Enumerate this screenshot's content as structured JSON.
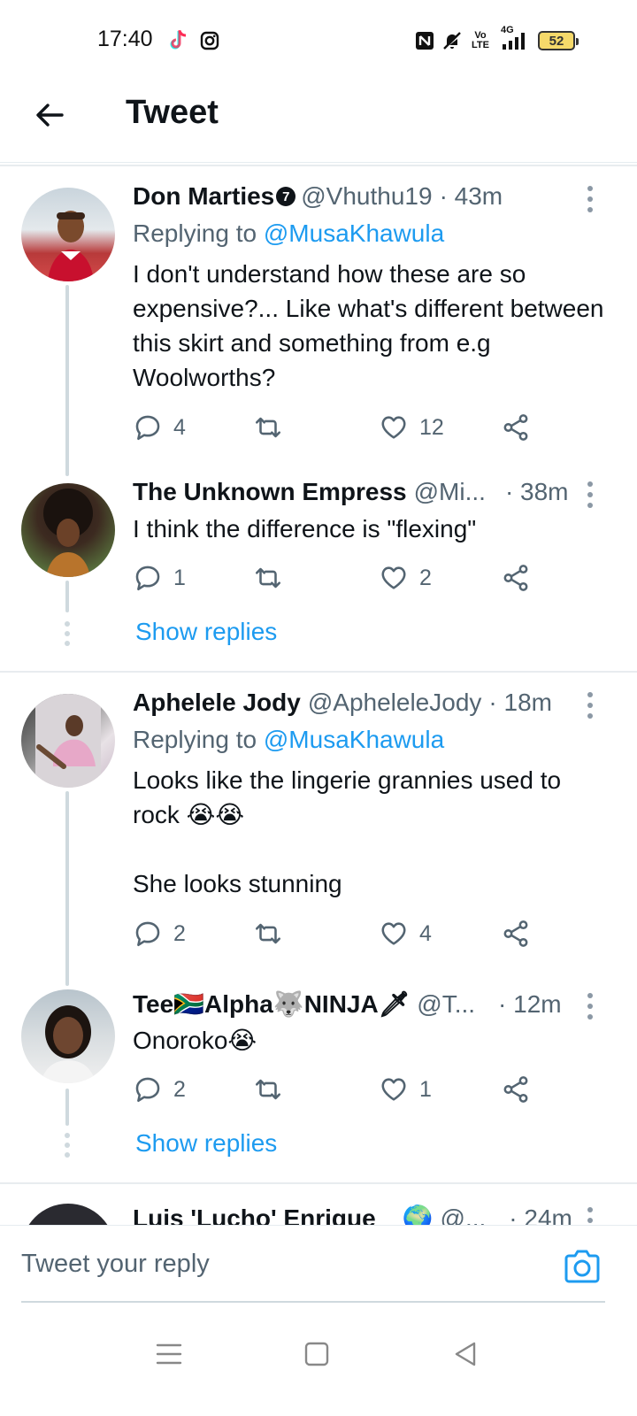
{
  "status_bar": {
    "time": "17:40",
    "battery": "52",
    "icons": [
      "tiktok-icon",
      "instagram-icon",
      "nfc-icon",
      "mute-icon",
      "volte-icon",
      "signal-4g-icon",
      "battery-icon"
    ],
    "volte_label": "Vo\nLTE",
    "network_label": "4G"
  },
  "header": {
    "title": "Tweet",
    "back_icon": "back-arrow-icon"
  },
  "tweets": [
    {
      "name": "Don Marties",
      "verified_badge": "7",
      "handle": "@Vhuthu19",
      "time": "· 43m",
      "reply_label": "Replying to ",
      "reply_mention": "@MusaKhawula",
      "text": "I don't understand how these are so expensive?... Like what's different between this skirt and something from e.g Woolworths?",
      "replies": "4",
      "retweets": "",
      "likes": "12"
    },
    {
      "name": "The Unknown Empress",
      "handle": "@Mi...",
      "time": "· 38m",
      "text": "I think the difference is \"flexing\"",
      "replies": "1",
      "retweets": "",
      "likes": "2",
      "show_replies": "Show replies"
    },
    {
      "name": "Aphelele Jody",
      "handle": "@ApheleleJody",
      "time": "· 18m",
      "reply_label": "Replying to ",
      "reply_mention": "@MusaKhawula",
      "text": "Looks like the lingerie grannies used to rock 😭😭\n\nShe looks stunning",
      "replies": "2",
      "retweets": "",
      "likes": "4"
    },
    {
      "name_parts": [
        "Tee",
        "🇿🇦",
        "Alpha",
        "🐺",
        " NINJA",
        "🗡"
      ],
      "handle": "@T...",
      "time": "· 12m",
      "text": "Onoroko😭",
      "replies": "2",
      "retweets": "",
      "likes": "1",
      "show_replies": "Show replies"
    },
    {
      "name": "Luis 'Lucho' Enrique",
      "name_emoji": "🌍",
      "handle": "@...",
      "time": "· 24m"
    }
  ],
  "reply_bar": {
    "placeholder": "Tweet your reply",
    "camera_icon": "camera-icon"
  },
  "nav_bar": {
    "icons": [
      "menu-icon",
      "home-square-icon",
      "back-triangle-icon"
    ]
  },
  "colors": {
    "link": "#1d9bf0",
    "secondary_text": "#536471",
    "thread_line": "#cfd9de"
  }
}
